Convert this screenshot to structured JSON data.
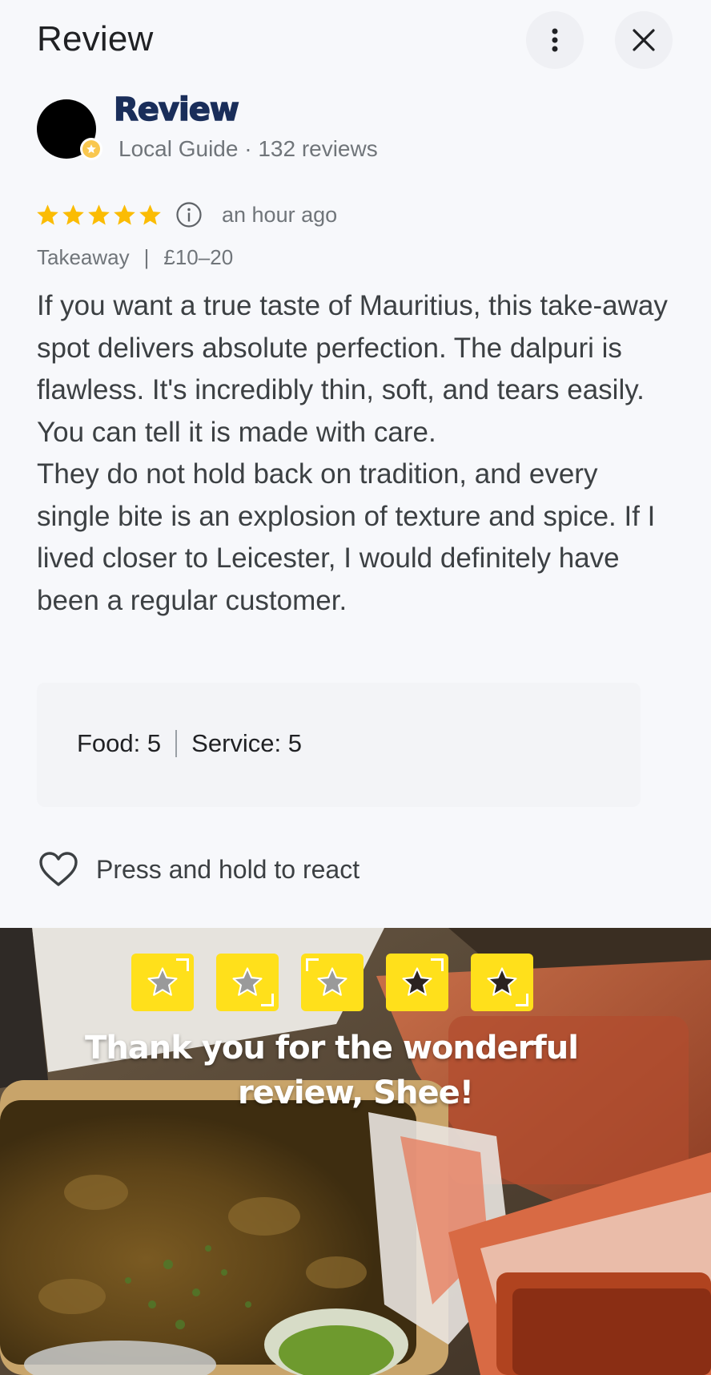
{
  "header": {
    "title": "Review",
    "more_icon": "more-vertical-icon",
    "close_icon": "close-icon"
  },
  "author": {
    "name": "Review",
    "meta": "Local Guide · 132 reviews",
    "badge_icon": "local-guide-badge-icon"
  },
  "review": {
    "rating": 5,
    "max_rating": 5,
    "star_color": "#fbbc04",
    "time": "an hour ago",
    "service_type": "Takeaway",
    "price_range": "£10–20",
    "paragraphs": [
      "If you want a true taste of Mauritius, this take-away spot delivers absolute perfection. The dalpuri is flawless. It's incredibly thin, soft, and tears easily. You can tell it is made with care.",
      "They do not hold back on tradition, and every single bite is an explosion of texture and spice. If I lived closer to Leicester, I would definitely have been a regular customer."
    ]
  },
  "sub_ratings": {
    "food_label": "Food:",
    "food_value": "5",
    "service_label": "Service:",
    "service_value": "5"
  },
  "react": {
    "label": "Press and hold to react",
    "icon": "heart-outline-icon"
  },
  "owner_photo": {
    "sticker_star_count": 5,
    "sticker_color": "#ffe01b",
    "message_line1": "Thank you for the wonderful",
    "message_line2": "review, Shee!"
  }
}
